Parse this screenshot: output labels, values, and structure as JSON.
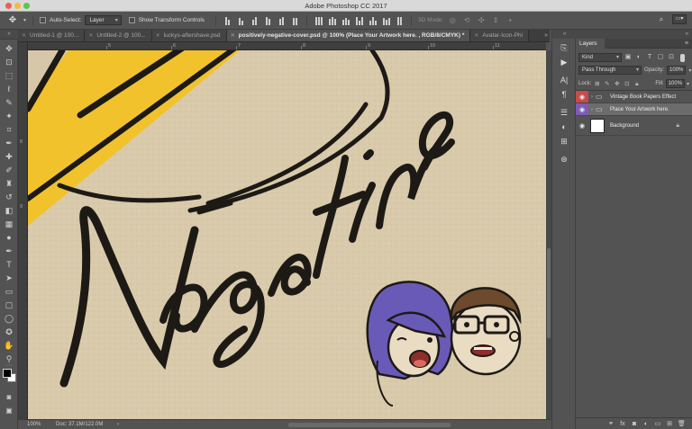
{
  "app": {
    "title": "Adobe Photoshop CC 2017"
  },
  "options_bar": {
    "auto_select_label": "Auto-Select:",
    "auto_select_value": "Layer",
    "show_transform_label": "Show Transform Controls",
    "mode_3d_label": "3D Mode:"
  },
  "tabs": [
    {
      "label": "Untitled-1 @ 100..."
    },
    {
      "label": "Untitled-2 @ 100..."
    },
    {
      "label": "luckys-aftershave.psd"
    },
    {
      "label": "positively-negative-cover.psd @ 100% (Place Your Artwork here. , RGB/8/CMYK) *"
    },
    {
      "label": "Avatar-Icon-Phi"
    }
  ],
  "ruler": {
    "h": [
      "5",
      "6",
      "7",
      "8",
      "9",
      "10",
      "11"
    ],
    "v": [
      "8",
      "9"
    ]
  },
  "status": {
    "zoom": "100%",
    "doc": "Doc: 37.1M/122.0M"
  },
  "layers_panel": {
    "tab_label": "Layers",
    "filter_kind": "Kind",
    "blend_mode": "Pass Through",
    "opacity_label": "Opacity:",
    "opacity_value": "100%",
    "lock_label": "Lock:",
    "fill_label": "Fill:",
    "fill_value": "100%",
    "layers": [
      {
        "name": "Vintage Book Papers Effect",
        "type": "group",
        "color": "#c64b4b"
      },
      {
        "name": "Place Your Artwork here.",
        "type": "group",
        "color": "#7e5cb4",
        "selected": true
      },
      {
        "name": "Background",
        "type": "pixel",
        "locked": true
      }
    ]
  },
  "artwork": {
    "text": "Negative",
    "paper_color": "#d6c7a8",
    "ink_color": "#1d1a16",
    "accent_color": "#f2c22c",
    "hair_color": "#6a5ab8"
  }
}
